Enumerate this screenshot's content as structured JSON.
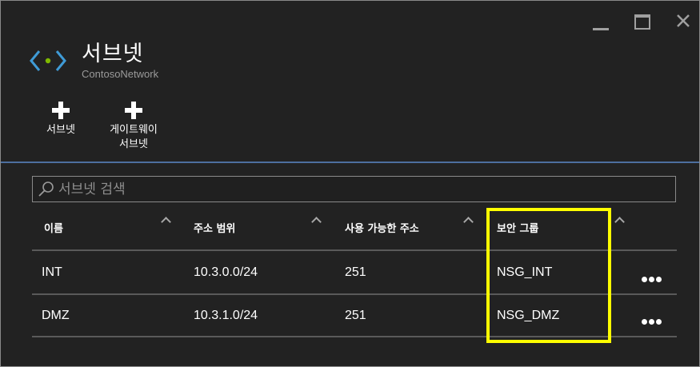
{
  "window": {
    "minimize_icon": "minimize-icon",
    "maximize_icon": "maximize-icon",
    "close_icon": "close-icon"
  },
  "header": {
    "title": "서브넷",
    "subtitle": "ContosoNetwork",
    "icon": "virtual-network-icon",
    "icon_color": "#3f9bd6",
    "dot_color": "#7fba00"
  },
  "commands": [
    {
      "label": "서브넷",
      "icon": "plus-icon"
    },
    {
      "label": "게이트웨이\n서브넷",
      "icon": "plus-icon"
    }
  ],
  "search": {
    "placeholder": "서브넷 검색",
    "value": ""
  },
  "table": {
    "columns": [
      "이름",
      "주소 범위",
      "사용 가능한 주소",
      "보안 그룹"
    ],
    "rows": [
      [
        "INT",
        "10.3.0.0/24",
        "251",
        "NSG_INT"
      ],
      [
        "DMZ",
        "10.3.1.0/24",
        "251",
        "NSG_DMZ"
      ]
    ]
  },
  "colors": {
    "accent_divider": "#4d6f9f",
    "highlight": "#ffff00",
    "background": "#222222"
  }
}
